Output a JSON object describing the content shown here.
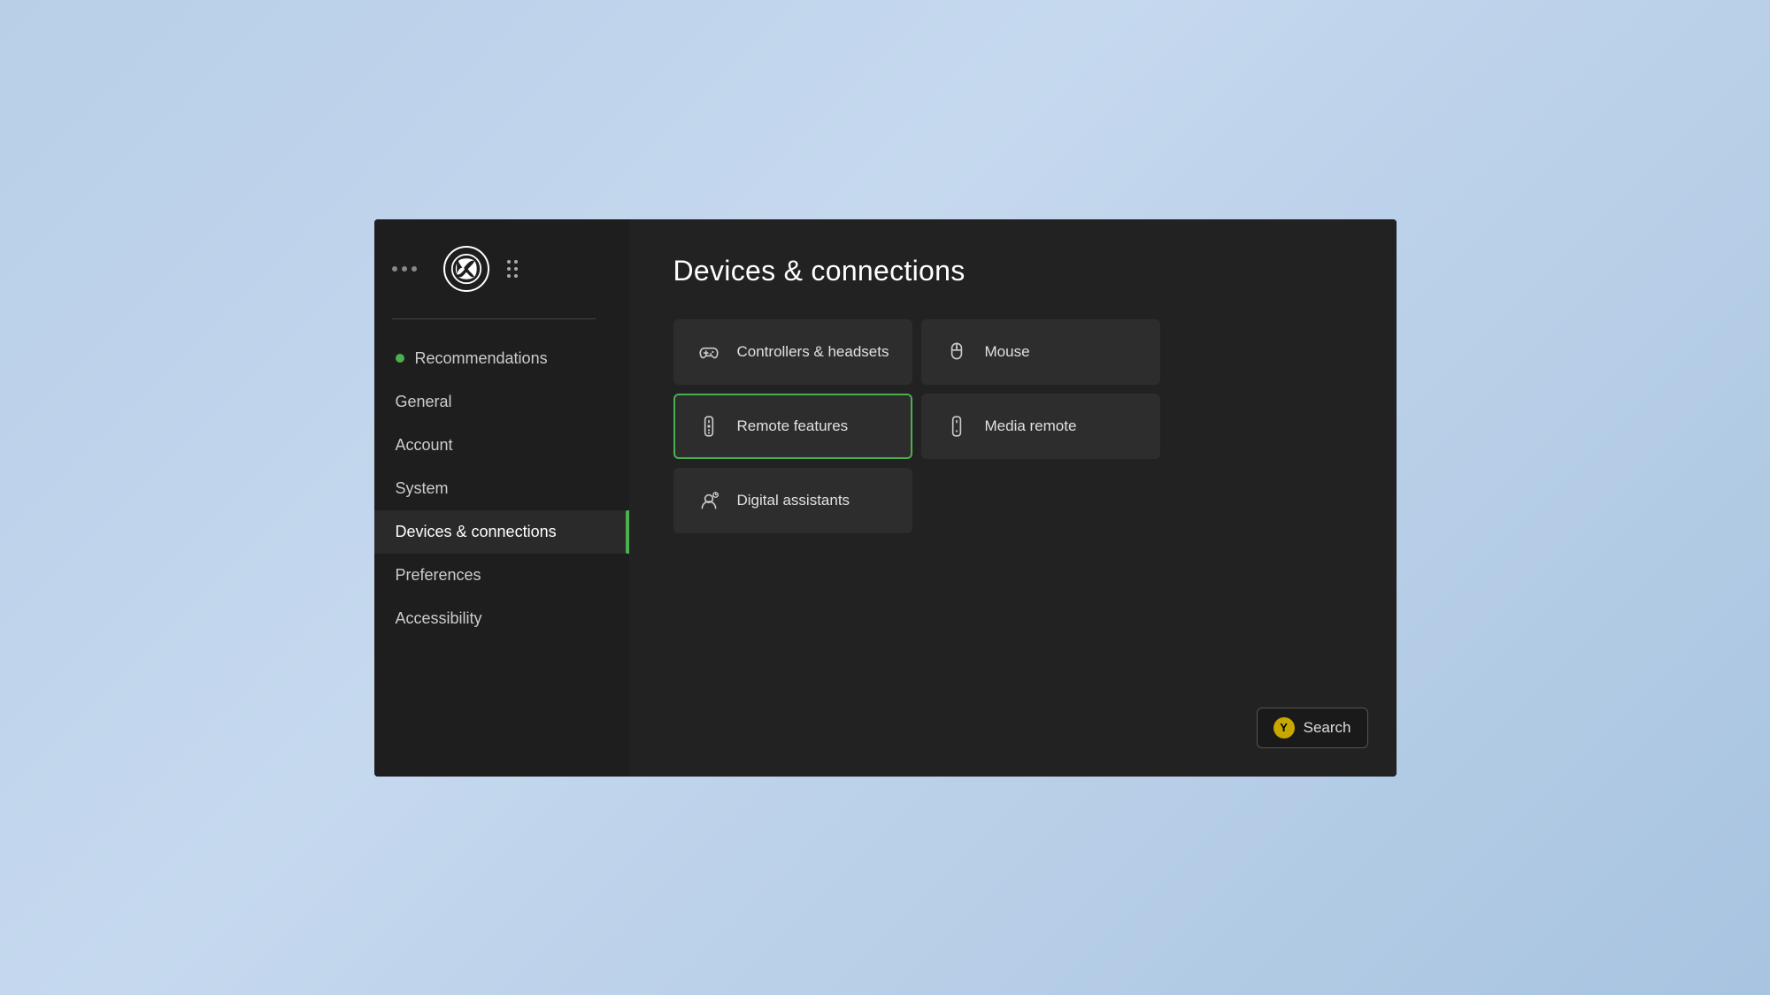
{
  "sidebar": {
    "nav_items": [
      {
        "id": "recommendations",
        "label": "Recommendations",
        "has_dot": true,
        "active": false
      },
      {
        "id": "general",
        "label": "General",
        "has_dot": false,
        "active": false
      },
      {
        "id": "account",
        "label": "Account",
        "has_dot": false,
        "active": false
      },
      {
        "id": "system",
        "label": "System",
        "has_dot": false,
        "active": false
      },
      {
        "id": "devices",
        "label": "Devices & connections",
        "has_dot": false,
        "active": true
      },
      {
        "id": "preferences",
        "label": "Preferences",
        "has_dot": false,
        "active": false
      },
      {
        "id": "accessibility",
        "label": "Accessibility",
        "has_dot": false,
        "active": false
      }
    ]
  },
  "main": {
    "page_title": "Devices & connections",
    "grid_items": [
      {
        "id": "controllers",
        "label": "Controllers & headsets",
        "icon": "controller",
        "selected": false
      },
      {
        "id": "mouse",
        "label": "Mouse",
        "icon": "mouse",
        "selected": false
      },
      {
        "id": "remote-features",
        "label": "Remote features",
        "icon": "remote",
        "selected": true
      },
      {
        "id": "media-remote",
        "label": "Media remote",
        "icon": "media-remote",
        "selected": false
      },
      {
        "id": "digital-assistants",
        "label": "Digital assistants",
        "icon": "assistant",
        "selected": false
      }
    ]
  },
  "search_button": {
    "label": "Search",
    "y_label": "Y"
  },
  "colors": {
    "selected_border": "#4caf50",
    "dot_color": "#4caf50",
    "y_button_bg": "#c8a800"
  }
}
